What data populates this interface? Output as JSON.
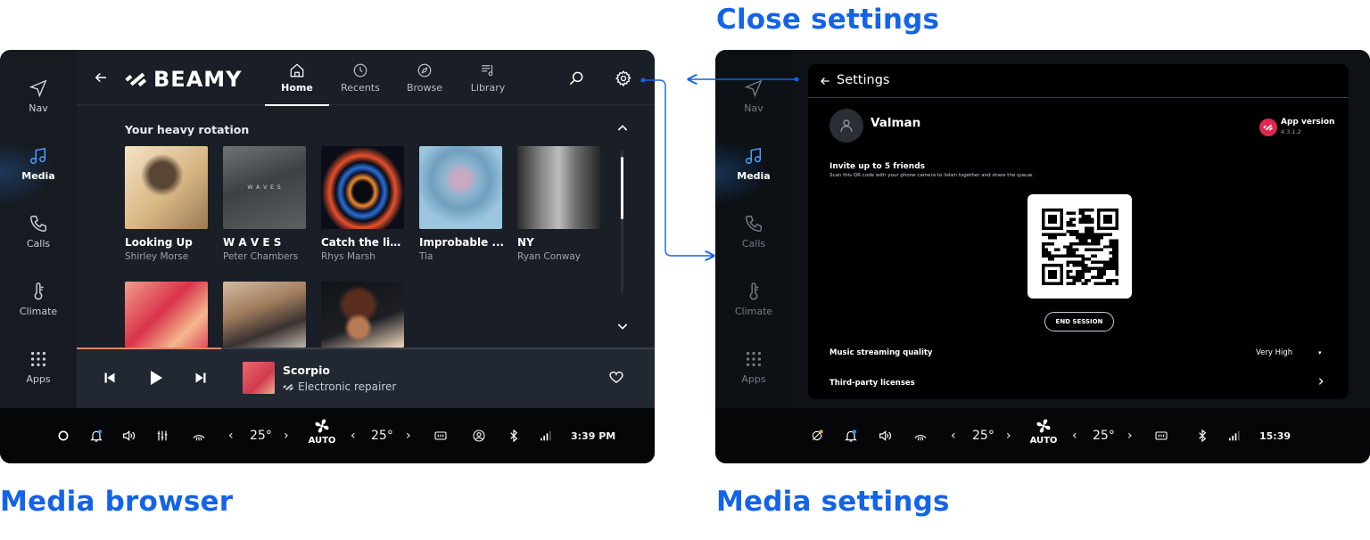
{
  "captions": {
    "media_browser": "Media browser",
    "media_settings": "Media settings",
    "close_settings": "Close settings"
  },
  "colors": {
    "caption_blue": "#1463e8",
    "app_background": "#1a1f27",
    "rail_background": "#161b22",
    "status_background": "#050607",
    "progress_accent": "#d98a6a",
    "version_logo": "#e0284d"
  },
  "rail": {
    "items": [
      {
        "label": "Nav",
        "icon": "navigation-arrow-icon"
      },
      {
        "label": "Media",
        "icon": "music-note-icon",
        "active": true
      },
      {
        "label": "Calls",
        "icon": "phone-icon"
      },
      {
        "label": "Climate",
        "icon": "thermometer-icon"
      },
      {
        "label": "Apps",
        "icon": "grid-icon"
      }
    ]
  },
  "header": {
    "brand": "BEAMY",
    "tabs": [
      {
        "label": "Home",
        "icon": "home-icon",
        "active": true
      },
      {
        "label": "Recents",
        "icon": "clock-icon"
      },
      {
        "label": "Browse",
        "icon": "compass-icon"
      },
      {
        "label": "Library",
        "icon": "library-icon"
      }
    ]
  },
  "rotation": {
    "title": "Your heavy rotation",
    "items": [
      {
        "title": "Looking Up",
        "artist": "Shirley Morse"
      },
      {
        "title": "W A V E S",
        "artist": "Peter Chambers"
      },
      {
        "title": "Catch the light",
        "artist": "Rhys Marsh"
      },
      {
        "title": "Improbable ...",
        "artist": "Tia"
      },
      {
        "title": "NY",
        "artist": "Ryan Conway"
      }
    ],
    "art_text": "W  A  V  E  S"
  },
  "now_playing": {
    "title": "Scorpio",
    "artist": "Electronic repairer",
    "progress": 0.25
  },
  "status_left": {
    "temp_left": "25°",
    "temp_right": "25°",
    "fan_mode": "AUTO",
    "time": "3:39 PM"
  },
  "status_right": {
    "temp_left": "25°",
    "temp_right": "25°",
    "fan_mode": "AUTO",
    "time": "15:39"
  },
  "settings": {
    "title": "Settings",
    "user_name": "Valman",
    "app_version_label": "App version",
    "app_version": "4.3.1.2",
    "invite_title": "Invite up to 5 friends",
    "invite_subtitle": "Scan this QR code with your phone camera to listen together and share the queue.",
    "end_session": "END SESSION",
    "quality_label": "Music streaming quality",
    "quality_value": "Very High",
    "licenses_label": "Third-party licenses"
  }
}
